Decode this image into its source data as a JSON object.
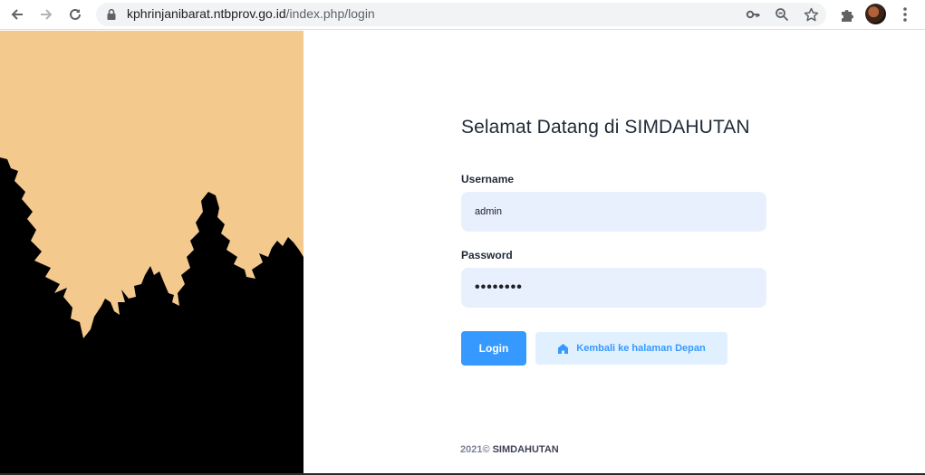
{
  "browser": {
    "url_host": "kphrinjanibarat.ntbprov.go.id",
    "url_path": "/index.php/login"
  },
  "login": {
    "title": "Selamat Datang di SIMDAHUTAN",
    "username_label": "Username",
    "username_value": "admin",
    "password_label": "Password",
    "password_value": "••••••••",
    "login_button": "Login",
    "back_button": "Kembali ke halaman Depan"
  },
  "footer": {
    "year": "2021©",
    "brand": "SIMDAHUTAN"
  },
  "colors": {
    "primary": "#3699ff",
    "primary_light": "#e1f0ff",
    "input_bg": "#e8f0fe",
    "sky": "#f3c98d",
    "forest": "#000000"
  }
}
